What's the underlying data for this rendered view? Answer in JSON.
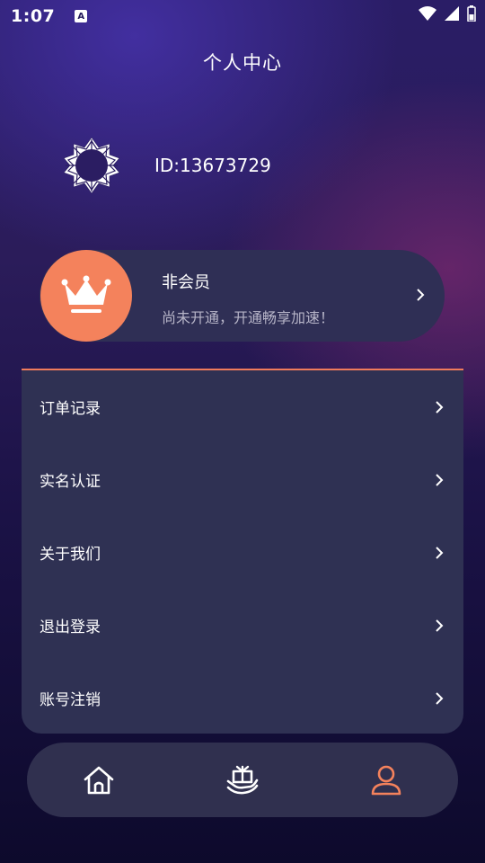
{
  "status_bar": {
    "time": "1:07",
    "notification_letter": "A"
  },
  "header": {
    "title": "个人中心"
  },
  "profile": {
    "user_id": "ID:13673729"
  },
  "membership": {
    "title": "非会员",
    "subtitle": "尚未开通，开通畅享加速！"
  },
  "menu": {
    "items": [
      {
        "label": "订单记录"
      },
      {
        "label": "实名认证"
      },
      {
        "label": "关于我们"
      },
      {
        "label": "退出登录"
      },
      {
        "label": "账号注销"
      }
    ]
  },
  "tabbar": {
    "tabs": [
      {
        "icon": "home-icon",
        "active": false
      },
      {
        "icon": "gift-icon",
        "active": false
      },
      {
        "icon": "profile-icon",
        "active": true
      }
    ]
  },
  "colors": {
    "accent": "#f4825c",
    "card": "#2f3153",
    "inactive_icon": "#ffffff"
  }
}
